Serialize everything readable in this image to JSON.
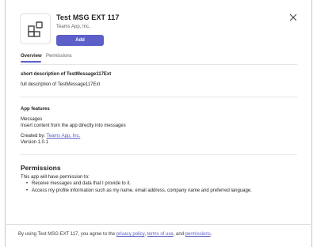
{
  "app": {
    "name": "Test MSG EXT 117",
    "publisher": "Teams App, Inc.",
    "add_label": "Add"
  },
  "tabs": [
    {
      "label": "Overview",
      "selected": true
    },
    {
      "label": "Permissions",
      "selected": false
    }
  ],
  "overview": {
    "short_description": "short description of TestMessage117Ext",
    "full_description": "full description of TestMessage117Ext",
    "features_heading": "App features",
    "feature_name": "Messages",
    "feature_description": "Insert content from the app directly into messages",
    "created_by_label": "Created by:",
    "created_by_link": "Teams App, Inc.",
    "version": "Version 1.0.1"
  },
  "permissions": {
    "heading": "Permissions",
    "intro": "This app will have permission to:",
    "items": [
      "Receive messages and data that I provide to it.",
      "Access my profile information such as my name, email address, company name and preferred language."
    ]
  },
  "footer": {
    "prefix": "By using Test MSG EXT 117, you agree to the",
    "privacy_link": "privacy policy",
    "sep1": ",",
    "terms_link": "terms of use",
    "sep2": ", and",
    "permissions_link": "permissions",
    "suffix": "."
  },
  "icons": {
    "app": "app-grid-icon",
    "close": "close-icon"
  },
  "colors": {
    "accent": "#5b5fc7",
    "text": "#242424",
    "muted": "#616161"
  }
}
